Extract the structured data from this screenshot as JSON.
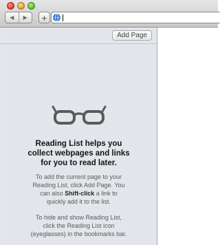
{
  "toolbar": {
    "back_glyph": "◀",
    "forward_glyph": "▶",
    "add_glyph": "+",
    "url_value": ""
  },
  "reading_list": {
    "add_page_label": "Add Page",
    "headline_line1": "Reading List helps you",
    "headline_line2": "collect webpages and links",
    "headline_line3": "for you to read later.",
    "para1_line1": "To add the current page to your",
    "para1_line2": "Reading List, click Add Page. You",
    "para1_line3_pre": "can also ",
    "para1_line3_bold": "Shift-click",
    "para1_line3_post": " a link to",
    "para1_line4": "quickly add it to the list.",
    "para2_line1": "To hide and show Reading List,",
    "para2_line2": "click the Reading List icon",
    "para2_line3": "(eyeglasses) in the bookmarks bar."
  },
  "icons": {
    "glasses": "eyeglasses-icon",
    "globe": "globe-icon"
  },
  "colors": {
    "sidebar_bg": "#e3e6ec",
    "glasses": "#5a5a5a",
    "close": "#e0443a",
    "minimize": "#e3a92a",
    "maximize": "#5fbf33"
  }
}
